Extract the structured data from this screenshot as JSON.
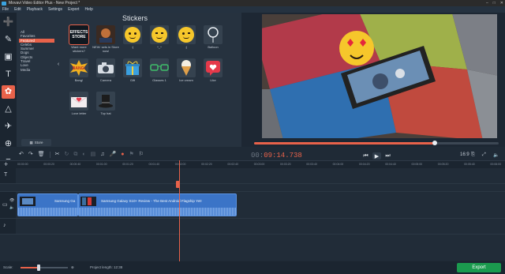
{
  "window": {
    "title": "Movavi Video Editor Plus - New Project *",
    "controls": [
      "–",
      "□",
      "✕"
    ]
  },
  "menu": [
    "File",
    "Edit",
    "Playback",
    "Settings",
    "Export",
    "Help"
  ],
  "tools": [
    {
      "name": "import-tool-icon",
      "glyph": "➕"
    },
    {
      "name": "filters-tool-icon",
      "glyph": "✎"
    },
    {
      "name": "transitions-tool-icon",
      "glyph": "▣"
    },
    {
      "name": "titles-tool-icon",
      "glyph": "T"
    },
    {
      "name": "stickers-tool-icon",
      "glyph": "✿",
      "active": true
    },
    {
      "name": "callouts-tool-icon",
      "glyph": "△"
    },
    {
      "name": "motion-tool-icon",
      "glyph": "✈"
    },
    {
      "name": "zoom-tool-icon",
      "glyph": "⊕"
    },
    {
      "name": "more-tools-icon",
      "glyph": "≡"
    }
  ],
  "categories": {
    "items": [
      "All",
      "Favorites",
      "Featured",
      "Celebs",
      "Summer",
      "Dogs",
      "Objects",
      "Travel",
      "Love",
      "Media"
    ],
    "selected": "Featured",
    "store_label": "Store"
  },
  "stickers": {
    "title": "Stickers",
    "items": [
      {
        "label": "Want more stickers?",
        "kind": "store"
      },
      {
        "label": "NEW: sets in Store now!",
        "kind": "new"
      },
      {
        "label": ":)",
        "kind": "smile"
      },
      {
        "label": "^_^",
        "kind": "happy"
      },
      {
        "label": ";)",
        "kind": "wink"
      },
      {
        "label": "Balloon",
        "kind": "balloon"
      },
      {
        "label": "Bang!",
        "kind": "bang"
      },
      {
        "label": "Camera",
        "kind": "camera"
      },
      {
        "label": "Gift",
        "kind": "gift"
      },
      {
        "label": "Glasses 1",
        "kind": "glasses"
      },
      {
        "label": "Ice cream",
        "kind": "icecream"
      },
      {
        "label": "Like",
        "kind": "like"
      },
      {
        "label": "Love letter",
        "kind": "letter"
      },
      {
        "label": "Top hat",
        "kind": "tophat"
      }
    ],
    "store_tile_text": "EFFECTS STORE"
  },
  "player": {
    "timecode_dim": "00:",
    "timecode": "09:14.738",
    "seek_progress": 0.74,
    "aspect_label": "16:9"
  },
  "timeline": {
    "ruler": [
      "00:00:00",
      "00:00:20",
      "00:00:40",
      "00:01:00",
      "00:01:20",
      "00:01:40",
      "00:02:00",
      "00:02:20",
      "00:02:40",
      "00:03:00",
      "00:03:20",
      "00:03:40",
      "00:04:00",
      "00:04:20",
      "00:04:40",
      "00:05:00",
      "00:05:20",
      "00:05:40",
      "00:06:00"
    ],
    "clips": [
      {
        "label": "Samsung Ga"
      },
      {
        "label": "Samsung Galaxy S10+ Review - The Best Android Flagship Yet!"
      }
    ]
  },
  "footer": {
    "scale_label": "Scale:",
    "scale_value": 0.38,
    "project_length_label": "Project length: 12:38",
    "export_label": "Export"
  },
  "colors": {
    "accent": "#e8624a",
    "clip": "#3b74c7",
    "export": "#1b9a4e"
  }
}
